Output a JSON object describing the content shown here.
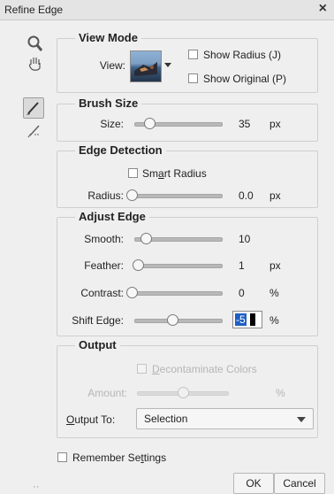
{
  "window": {
    "title": "Refine Edge",
    "close_glyph": "×"
  },
  "tools": [
    "zoom-tool-icon",
    "hand-tool-icon",
    "refine-radius-brush-icon",
    "erase-refinements-icon"
  ],
  "view_mode": {
    "title": "View Mode",
    "view_label": "View:",
    "show_radius": {
      "label": "Show Radius (J)",
      "checked": false
    },
    "show_original": {
      "label": "Show Original (P)",
      "checked": false
    }
  },
  "brush_size": {
    "title": "Brush Size",
    "label": "Size:",
    "value": "35",
    "unit": "px",
    "level": 0.16
  },
  "edge_detection": {
    "title": "Edge Detection",
    "smart_radius": {
      "pre": "Sm",
      "ul": "a",
      "post": "rt Radius",
      "checked": false
    },
    "radius": {
      "label": "Radius:",
      "value": "0.0",
      "unit": "px",
      "level": 0.0
    }
  },
  "adjust_edge": {
    "title": "Adjust Edge",
    "smooth": {
      "label": "Smooth:",
      "value": "10",
      "unit": "",
      "level": 0.12
    },
    "feather": {
      "label": "Feather:",
      "value": "1",
      "unit": "px",
      "level": 0.02
    },
    "contrast": {
      "label": "Contrast:",
      "value": "0",
      "unit": "%",
      "level": 0.0
    },
    "shift_edge": {
      "label": "Shift Edge:",
      "value": "-5",
      "unit": "%",
      "level": 0.45
    }
  },
  "output": {
    "title": "Output",
    "decontaminate": {
      "ul": "D",
      "post": "econtaminate Colors",
      "checked": false
    },
    "amount": {
      "label": "Amount:",
      "unit": "%"
    },
    "output_to": {
      "ul": "O",
      "post": "utput To:",
      "value": "Selection"
    }
  },
  "remember": {
    "pre": "Remember Se",
    "ul": "t",
    "post": "tings",
    "checked": false
  },
  "buttons": {
    "ok": "OK",
    "cancel": "Cancel"
  }
}
